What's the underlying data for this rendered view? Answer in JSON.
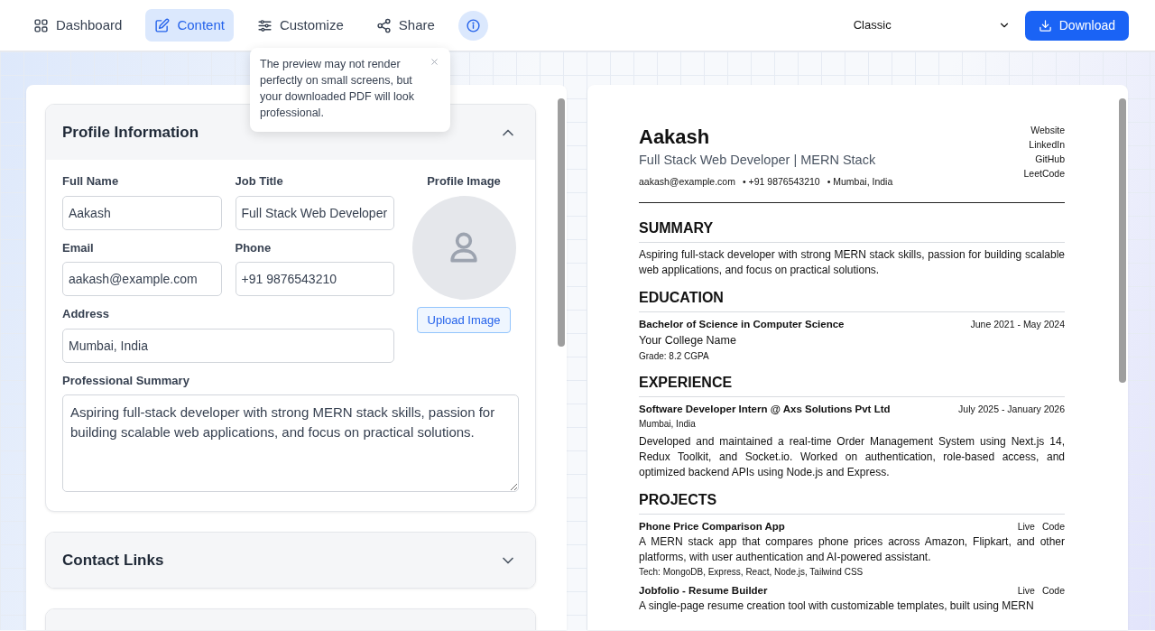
{
  "nav": {
    "tabs": [
      {
        "label": "Dashboard",
        "selected": false
      },
      {
        "label": "Content",
        "selected": true
      },
      {
        "label": "Customize",
        "selected": false
      },
      {
        "label": "Share",
        "selected": false
      }
    ],
    "info_button": {
      "active": true
    },
    "template_select": {
      "value": "Classic"
    },
    "download_button": {
      "label": "Download"
    }
  },
  "tooltip": {
    "text": "The preview may not render perfectly on small screens, but your downloaded PDF will look professional."
  },
  "editor": {
    "sections": [
      {
        "title": "Profile Information",
        "expanded": true,
        "fields": [
          {
            "kind": "input",
            "label": "Full Name",
            "value": "Aakash"
          },
          {
            "kind": "input",
            "label": "Job Title",
            "value": "Full Stack Web Developer"
          },
          {
            "kind": "input",
            "label": "Email",
            "value": "aakash@example.com"
          },
          {
            "kind": "input",
            "label": "Phone",
            "value": "+91 9876543210"
          },
          {
            "kind": "input",
            "label": "Address",
            "value": "Mumbai, India"
          },
          {
            "kind": "textarea",
            "label": "Professional Summary",
            "value": "Aspiring full-stack developer with strong MERN stack skills, passion for building scalable web applications, and focus on practical solutions."
          }
        ],
        "profile_image": {
          "label": "Profile Image",
          "button": "Upload Image"
        }
      },
      {
        "title": "Contact Links",
        "expanded": false
      },
      {
        "expanded": false
      }
    ]
  },
  "preview": {
    "name": "Aakash",
    "headline": "Full Stack Web Developer | MERN Stack",
    "contacts": [
      "aakash@example.com",
      "• +91 9876543210",
      "• Mumbai, India"
    ],
    "links": [
      "Website",
      "LinkedIn",
      "GitHub",
      "LeetCode"
    ],
    "sections": [
      {
        "kind": "text",
        "heading": "SUMMARY",
        "text": "Aspiring full-stack developer with strong MERN stack skills, passion for building scalable web applications, and focus on practical solutions."
      },
      {
        "kind": "education",
        "heading": "EDUCATION",
        "entries": [
          {
            "degree": "Bachelor of Science in Computer Science",
            "dates": "June 2021 - May 2024",
            "school": "Your College Name",
            "grade": "Grade: 8.2 CGPA"
          }
        ]
      },
      {
        "kind": "experience",
        "heading": "EXPERIENCE",
        "entries": [
          {
            "role": "Software Developer Intern @ Axs Solutions Pvt Ltd",
            "dates": "July 2025 - January 2026",
            "location": "Mumbai, India",
            "text": "Developed and maintained a real-time Order Management System using Next.js 14, Redux Toolkit, and Socket.io. Worked on authentication, role-based access, and optimized backend APIs using Node.js and Express."
          }
        ]
      },
      {
        "kind": "projects",
        "heading": "PROJECTS",
        "entries": [
          {
            "title": "Phone Price Comparison App",
            "links": [
              "Live",
              "Code"
            ],
            "text": "A MERN stack app that compares phone prices across Amazon, Flipkart, and other platforms, with user authentication and AI-powered assistant.",
            "tech": "Tech: MongoDB, Express, React, Node.js, Tailwind CSS"
          },
          {
            "title": "Jobfolio - Resume Builder",
            "links": [
              "Live",
              "Code"
            ],
            "text": "A single-page resume creation tool with customizable templates, built using MERN"
          }
        ]
      }
    ]
  }
}
